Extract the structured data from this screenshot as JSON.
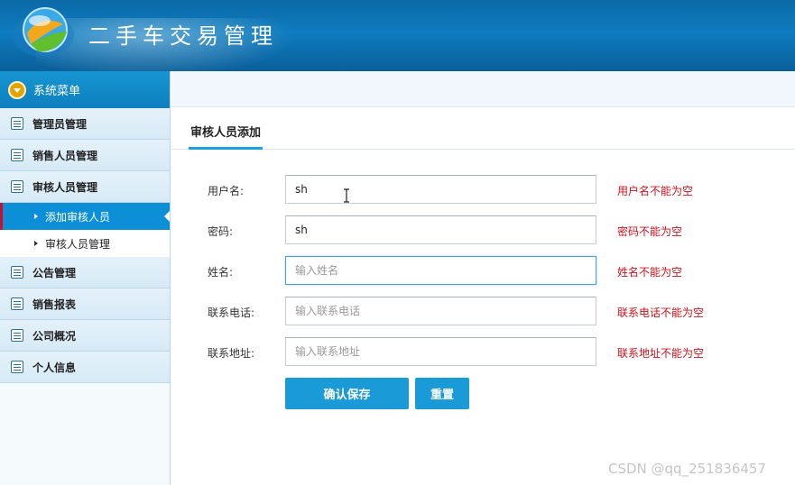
{
  "header": {
    "title": "二手车交易管理"
  },
  "sidebar": {
    "title": "系统菜单",
    "items": [
      {
        "label": "管理员管理"
      },
      {
        "label": "销售人员管理"
      },
      {
        "label": "审核人员管理",
        "children": [
          {
            "label": "添加审核人员",
            "active": true
          },
          {
            "label": "审核人员管理"
          }
        ]
      },
      {
        "label": "公告管理"
      },
      {
        "label": "销售报表"
      },
      {
        "label": "公司概况"
      },
      {
        "label": "个人信息"
      }
    ]
  },
  "main": {
    "tab": "审核人员添加",
    "form": {
      "username": {
        "label": "用户名:",
        "value": "sh",
        "error": "用户名不能为空"
      },
      "password": {
        "label": "密码:",
        "value": "sh",
        "error": "密码不能为空"
      },
      "name": {
        "label": "姓名:",
        "placeholder": "输入姓名",
        "error": "姓名不能为空"
      },
      "phone": {
        "label": "联系电话:",
        "placeholder": "输入联系电话",
        "error": "联系电话不能为空"
      },
      "address": {
        "label": "联系地址:",
        "placeholder": "输入联系地址",
        "error": "联系地址不能为空"
      }
    },
    "buttons": {
      "save": "确认保存",
      "reset": "重置"
    }
  },
  "watermark": "CSDN @qq_251836457",
  "colors": {
    "header": "#0e7cc0",
    "accent": "#1a9ad6",
    "error": "#d0101b"
  }
}
